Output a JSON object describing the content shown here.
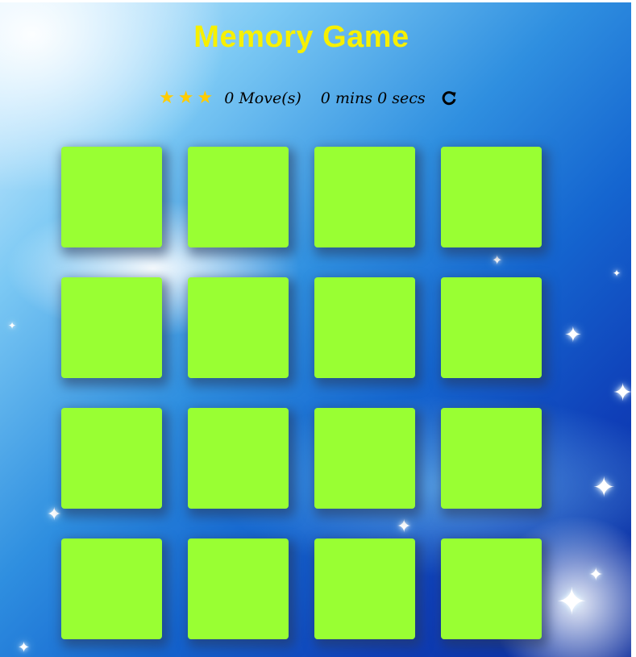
{
  "game": {
    "title": "Memory Game",
    "card_color": "#99ff33",
    "title_color": "#f7f000",
    "star_color": "#ffcc00"
  },
  "score_panel": {
    "star_rating": 3,
    "stars": [
      "star-icon",
      "star-icon",
      "star-icon"
    ],
    "moves_count": "0",
    "moves_label": "Move(s)",
    "minutes": "0",
    "minutes_label": "mins",
    "seconds": "0",
    "seconds_label": "secs",
    "restart_icon": "restart-icon"
  },
  "deck": {
    "rows": 4,
    "columns": 4,
    "cards": [
      {
        "state": "face-down"
      },
      {
        "state": "face-down"
      },
      {
        "state": "face-down"
      },
      {
        "state": "face-down"
      },
      {
        "state": "face-down"
      },
      {
        "state": "face-down"
      },
      {
        "state": "face-down"
      },
      {
        "state": "face-down"
      },
      {
        "state": "face-down"
      },
      {
        "state": "face-down"
      },
      {
        "state": "face-down"
      },
      {
        "state": "face-down"
      },
      {
        "state": "face-down"
      },
      {
        "state": "face-down"
      },
      {
        "state": "face-down"
      },
      {
        "state": "face-down"
      }
    ]
  }
}
